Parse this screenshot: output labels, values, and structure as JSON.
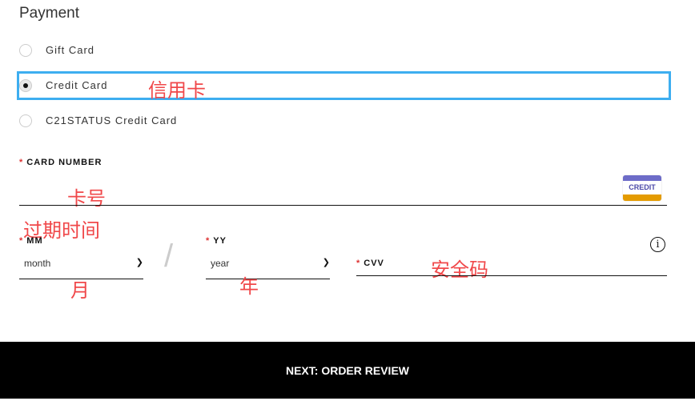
{
  "title": "Payment",
  "options": [
    {
      "label": "Gift Card",
      "selected": false
    },
    {
      "label": "Credit Card",
      "selected": true
    },
    {
      "label": "C21STATUS Credit Card",
      "selected": false
    }
  ],
  "card_number": {
    "label": "CARD NUMBER",
    "value": "",
    "badge": "CREDIT"
  },
  "mm": {
    "label": "MM",
    "value": "month"
  },
  "yy": {
    "label": "YY",
    "value": "year"
  },
  "separator": "/",
  "cvv": {
    "label": "CVV",
    "value": ""
  },
  "required_mark": "*",
  "annotations": {
    "credit_card": "信用卡",
    "card_number": "卡号",
    "expiry": "过期时间",
    "month": "月",
    "year": "年",
    "cvv": "安全码"
  },
  "next_button": "NEXT: ORDER REVIEW",
  "colors": {
    "highlight": "#3daef0",
    "annotation": "#f0484a",
    "required": "#dd3333",
    "button": "#000000"
  }
}
